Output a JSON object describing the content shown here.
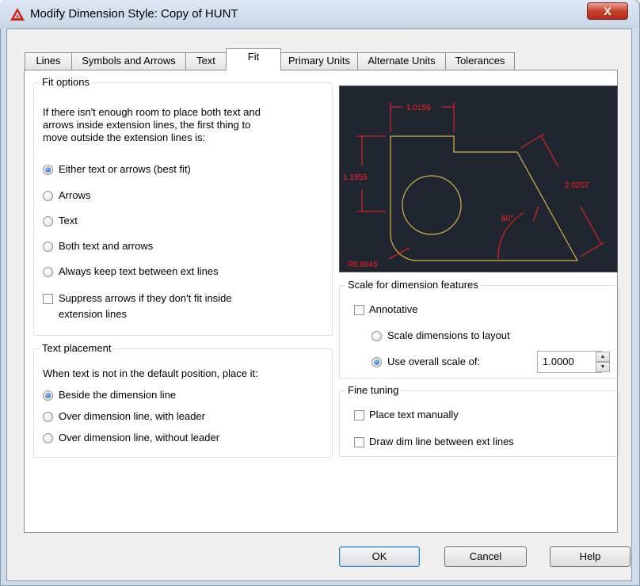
{
  "window": {
    "title": "Modify Dimension Style: Copy of HUNT",
    "close_label": "X"
  },
  "tabs": [
    {
      "label": "Lines",
      "active": false
    },
    {
      "label": "Symbols and Arrows",
      "active": false
    },
    {
      "label": "Text",
      "active": false
    },
    {
      "label": "Fit",
      "active": true
    },
    {
      "label": "Primary Units",
      "active": false
    },
    {
      "label": "Alternate Units",
      "active": false
    },
    {
      "label": "Tolerances",
      "active": false
    }
  ],
  "fit_options": {
    "title": "Fit options",
    "description": [
      "If there isn't enough room to place both text and",
      "arrows inside extension lines, the first thing to",
      "move outside the extension lines is:"
    ],
    "options": [
      {
        "label": "Either text or arrows (best fit)",
        "selected": true
      },
      {
        "label": "Arrows",
        "selected": false
      },
      {
        "label": "Text",
        "selected": false
      },
      {
        "label": "Both text and arrows",
        "selected": false
      },
      {
        "label": "Always keep text between ext lines",
        "selected": false
      }
    ],
    "suppress_label": [
      "Suppress arrows if they don't fit inside",
      "extension lines"
    ],
    "suppress_checked": false
  },
  "text_placement": {
    "title": "Text placement",
    "description": "When text is not in the default position, place it:",
    "options": [
      {
        "label": "Beside the dimension line",
        "selected": true
      },
      {
        "label": "Over dimension line, with leader",
        "selected": false
      },
      {
        "label": "Over dimension line, without leader",
        "selected": false
      }
    ]
  },
  "preview": {
    "dim_top": "1.0159",
    "dim_left": "1.1955",
    "dim_right": "2.0207",
    "dim_angle": "60°",
    "dim_radius": "R0.8045",
    "line_color": "#d6b44a",
    "dim_color": "#ff2020"
  },
  "scale": {
    "title": "Scale for dimension features",
    "annotative_label": "Annotative",
    "annotative_checked": false,
    "options": [
      {
        "label": "Scale dimensions to layout",
        "selected": false
      },
      {
        "label": "Use overall scale of:",
        "selected": true
      }
    ],
    "overall_scale_value": "1.0000"
  },
  "fine_tuning": {
    "title": "Fine tuning",
    "place_text_manually": "Place text manually",
    "draw_dim_line": "Draw dim line between ext lines"
  },
  "buttons": {
    "ok": "OK",
    "cancel": "Cancel",
    "help": "Help"
  }
}
